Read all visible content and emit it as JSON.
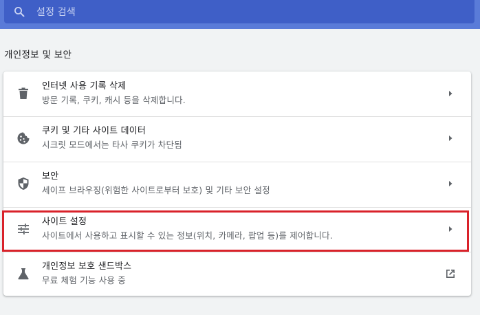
{
  "search": {
    "placeholder": "설정 검색"
  },
  "section": {
    "title": "개인정보 및 보안"
  },
  "items": [
    {
      "label": "인터넷 사용 기록 삭제",
      "sub": "방문 기록, 쿠키, 캐시 등을 삭제합니다.",
      "icon": "trash-icon",
      "action": "arrow-right-icon"
    },
    {
      "label": "쿠키 및 기타 사이트 데이터",
      "sub": "시크릿 모드에서는 타사 쿠키가 차단됨",
      "icon": "cookie-icon",
      "action": "arrow-right-icon"
    },
    {
      "label": "보안",
      "sub": "세이프 브라우징(위험한 사이트로부터 보호) 및 기타 보안 설정",
      "icon": "shield-icon",
      "action": "arrow-right-icon"
    },
    {
      "label": "사이트 설정",
      "sub": "사이트에서 사용하고 표시할 수 있는 정보(위치, 카메라, 팝업 등)를 제어합니다.",
      "icon": "tune-icon",
      "action": "arrow-right-icon",
      "highlighted": true
    },
    {
      "label": "개인정보 보호 샌드박스",
      "sub": "무료 체험 기능 사용 중",
      "icon": "flask-icon",
      "action": "open-in-new-icon"
    }
  ],
  "colors": {
    "header": "#5a7bd8",
    "search_bg": "#3f5fc7",
    "highlight": "#d9222a"
  }
}
